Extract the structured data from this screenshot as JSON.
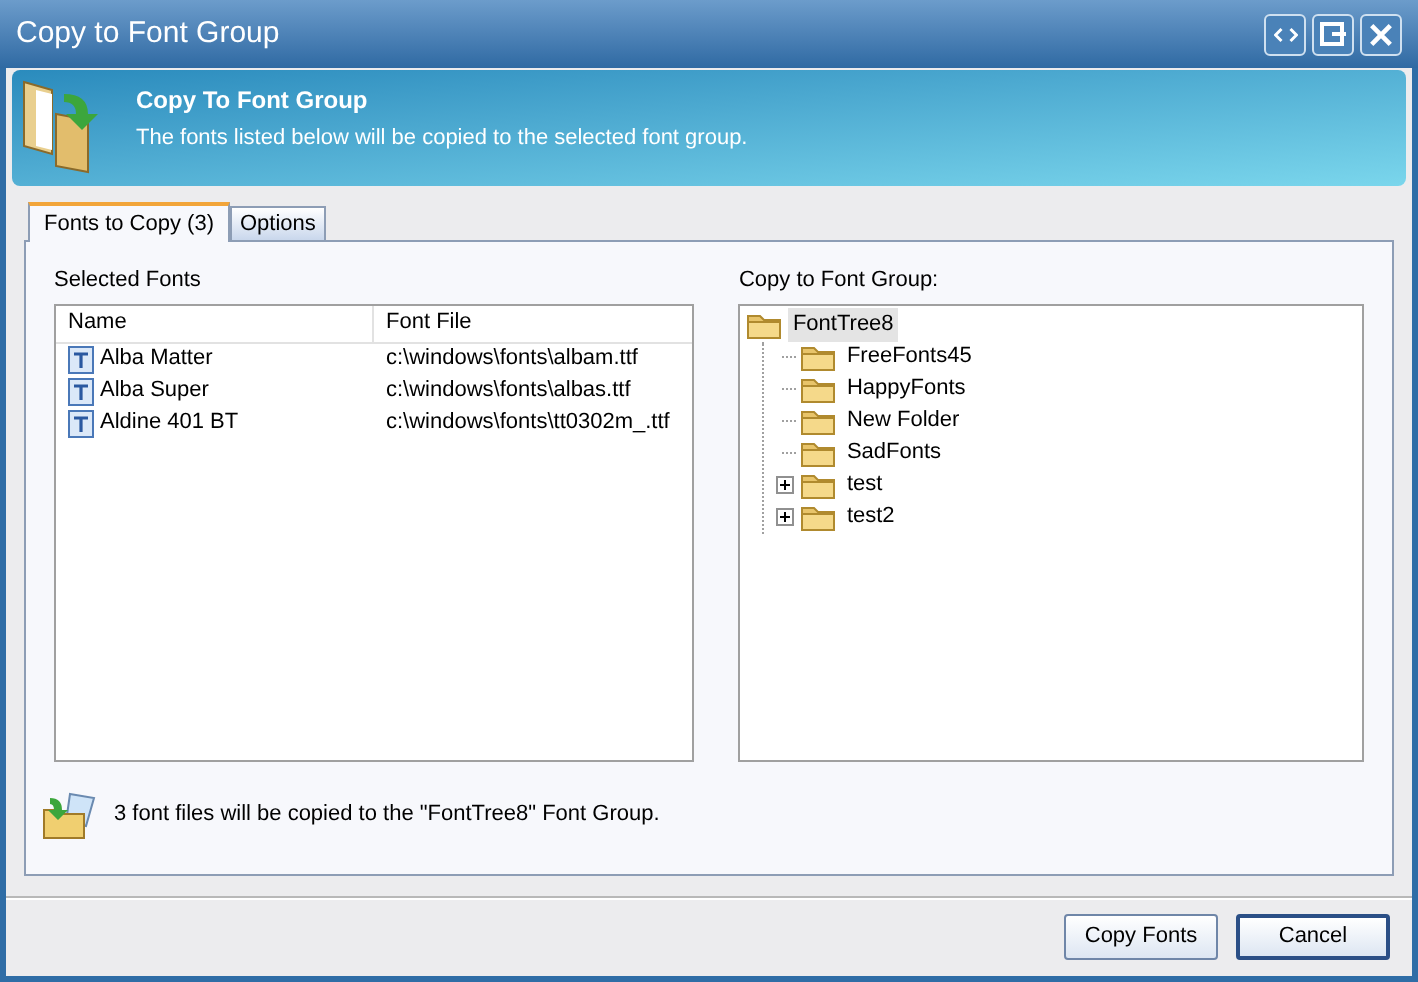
{
  "window": {
    "title": "Copy to Font Group"
  },
  "header": {
    "title": "Copy To Font Group",
    "description": "The fonts listed below will be copied to the selected font group."
  },
  "tabs": [
    {
      "label": "Fonts to Copy (3)",
      "selected": true
    },
    {
      "label": "Options",
      "selected": false
    }
  ],
  "selected_fonts": {
    "label": "Selected Fonts",
    "columns": [
      "Name",
      "Font File"
    ],
    "rows": [
      {
        "name": "Alba Matter",
        "file": "c:\\windows\\fonts\\albam.ttf"
      },
      {
        "name": "Alba Super",
        "file": "c:\\windows\\fonts\\albas.ttf"
      },
      {
        "name": "Aldine 401 BT",
        "file": "c:\\windows\\fonts\\tt0302m_.ttf"
      }
    ]
  },
  "font_group": {
    "label": "Copy to Font Group:",
    "tree": [
      {
        "label": "FontTree8",
        "selected": true,
        "expanded": true,
        "children": [
          {
            "label": "FreeFonts45",
            "selected": false
          },
          {
            "label": "HappyFonts",
            "selected": false
          },
          {
            "label": "New Folder",
            "selected": false
          },
          {
            "label": "SadFonts",
            "selected": false
          },
          {
            "label": "test",
            "selected": false,
            "expanded": false
          },
          {
            "label": "test2",
            "selected": false,
            "expanded": false
          }
        ]
      }
    ]
  },
  "status": "3 font files will be copied to the \"FontTree8\" Font Group.",
  "buttons": [
    "Copy Fonts",
    "Cancel"
  ]
}
